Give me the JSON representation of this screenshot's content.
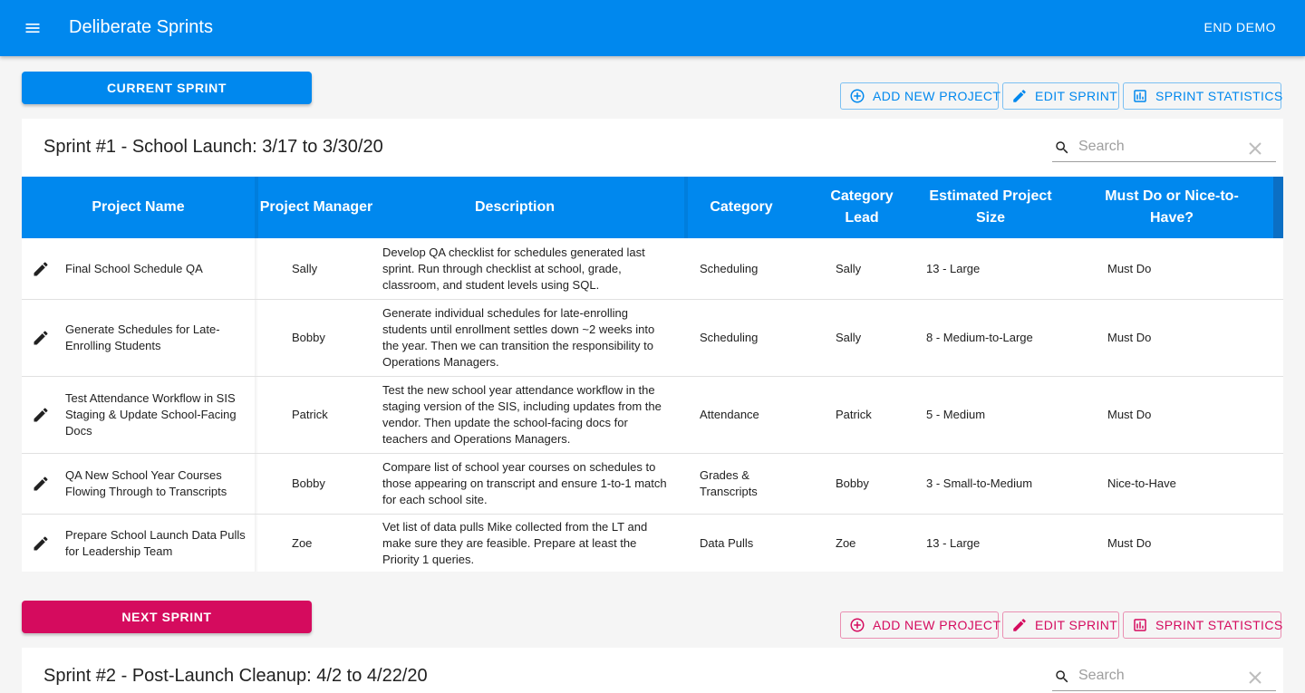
{
  "app": {
    "title": "Deliberate Sprints",
    "end_demo_label": "END DEMO"
  },
  "table_headers": [
    "Project Name",
    "Project Manager",
    "Description",
    "Category",
    "Category Lead",
    "Estimated Project Size",
    "Must Do or Nice-to-Have?"
  ],
  "current_sprint": {
    "button_label": "CURRENT SPRINT",
    "accent_color": "#0088ee",
    "actions": {
      "add_project": "ADD NEW PROJECT",
      "edit_sprint": "EDIT SPRINT",
      "statistics": "SPRINT STATISTICS"
    },
    "title": "Sprint #1 - School Launch: 3/17 to 3/30/20",
    "search_placeholder": "Search",
    "rows": [
      {
        "project": "Final School Schedule QA",
        "manager": "Sally",
        "description": "Develop QA checklist for schedules generated last sprint. Run through checklist at school, grade, classroom, and student levels using SQL.",
        "category": "Scheduling",
        "lead": "Sally",
        "size": "13 - Large",
        "priority": "Must Do"
      },
      {
        "project": "Generate Schedules for Late-Enrolling Students",
        "manager": "Bobby",
        "description": "Generate individual schedules for late-enrolling students until enrollment settles down ~2 weeks into the year. Then we can transition the responsibility to Operations Managers.",
        "category": "Scheduling",
        "lead": "Sally",
        "size": "8 - Medium-to-Large",
        "priority": "Must Do"
      },
      {
        "project": "Test Attendance Workflow in SIS Staging & Update School-Facing Docs",
        "manager": "Patrick",
        "description": "Test the new school year attendance workflow in the staging version of the SIS, including updates from the vendor. Then update the school-facing docs for teachers and Operations Managers.",
        "category": "Attendance",
        "lead": "Patrick",
        "size": "5 - Medium",
        "priority": "Must Do"
      },
      {
        "project": "QA New School Year Courses Flowing Through to Transcripts",
        "manager": "Bobby",
        "description": "Compare list of school year courses on schedules to those appearing on transcript and ensure 1-to-1 match for each school site.",
        "category": "Grades & Transcripts",
        "lead": "Bobby",
        "size": "3 - Small-to-Medium",
        "priority": "Nice-to-Have"
      },
      {
        "project": "Prepare School Launch Data Pulls for Leadership Team",
        "manager": "Zoe",
        "description": "Vet list of data pulls Mike collected from the LT and make sure they are feasible. Prepare at least the Priority 1 queries.",
        "category": "Data Pulls",
        "lead": "Zoe",
        "size": "13 - Large",
        "priority": "Must Do"
      }
    ]
  },
  "next_sprint": {
    "button_label": "NEXT SPRINT",
    "accent_color": "#d50b5e",
    "actions": {
      "add_project": "ADD NEW PROJECT",
      "edit_sprint": "EDIT SPRINT",
      "statistics": "SPRINT STATISTICS"
    },
    "title": "Sprint #2 - Post-Launch Cleanup: 4/2 to 4/22/20",
    "search_placeholder": "Search"
  },
  "icons": [
    "menu-icon",
    "add-circle-icon",
    "pencil-icon",
    "bar-chart-icon",
    "search-icon",
    "close-icon",
    "edit-icon"
  ]
}
